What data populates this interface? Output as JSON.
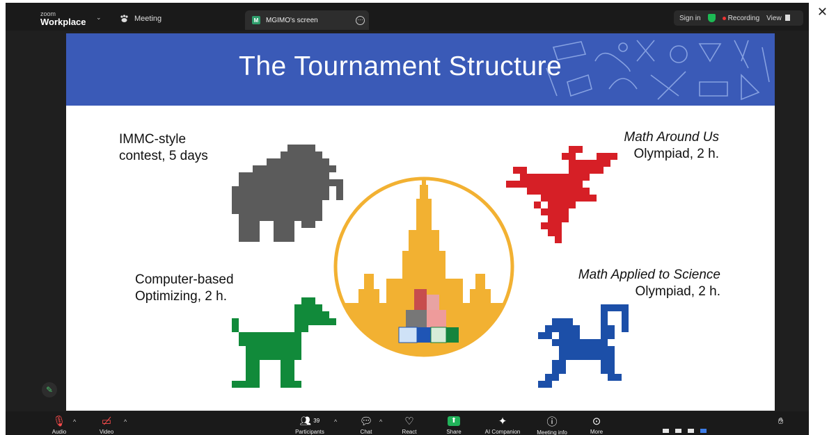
{
  "topbar": {
    "brand_small": "zoom",
    "brand_main": "Workplace",
    "meeting_label": "Meeting",
    "screen_tab_badge": "M",
    "screen_tab_label": "MGIMO's screen",
    "sign_in": "Sign in",
    "recording": "Recording",
    "view": "View"
  },
  "slide": {
    "title": "The Tournament Structure",
    "tl_line1": "IMMC-style",
    "tl_line2": "contest, 5 days",
    "tr_line1": "Math Around Us",
    "tr_line2": "Olympiad, 2 h.",
    "bl_line1": "Computer-based",
    "bl_line2": "Optimizing, 2 h.",
    "br_line1": "Math Applied to Science",
    "br_line2": "Olympiad, 2 h.",
    "colors": {
      "banner": "#3a5ab7",
      "mammoth": "#5b5b5b",
      "scorpion": "#d61f26",
      "dog": "#118a3a",
      "monkey": "#1c4fa8",
      "emblem_ring": "#f2b132"
    }
  },
  "toolbar": {
    "audio": "Audio",
    "video": "Video",
    "participants": "Participants",
    "participants_count": "39",
    "chat": "Chat",
    "react": "React",
    "share": "Share",
    "ai_companion": "AI Companion",
    "meeting_info": "Meeting info",
    "more": "More"
  }
}
